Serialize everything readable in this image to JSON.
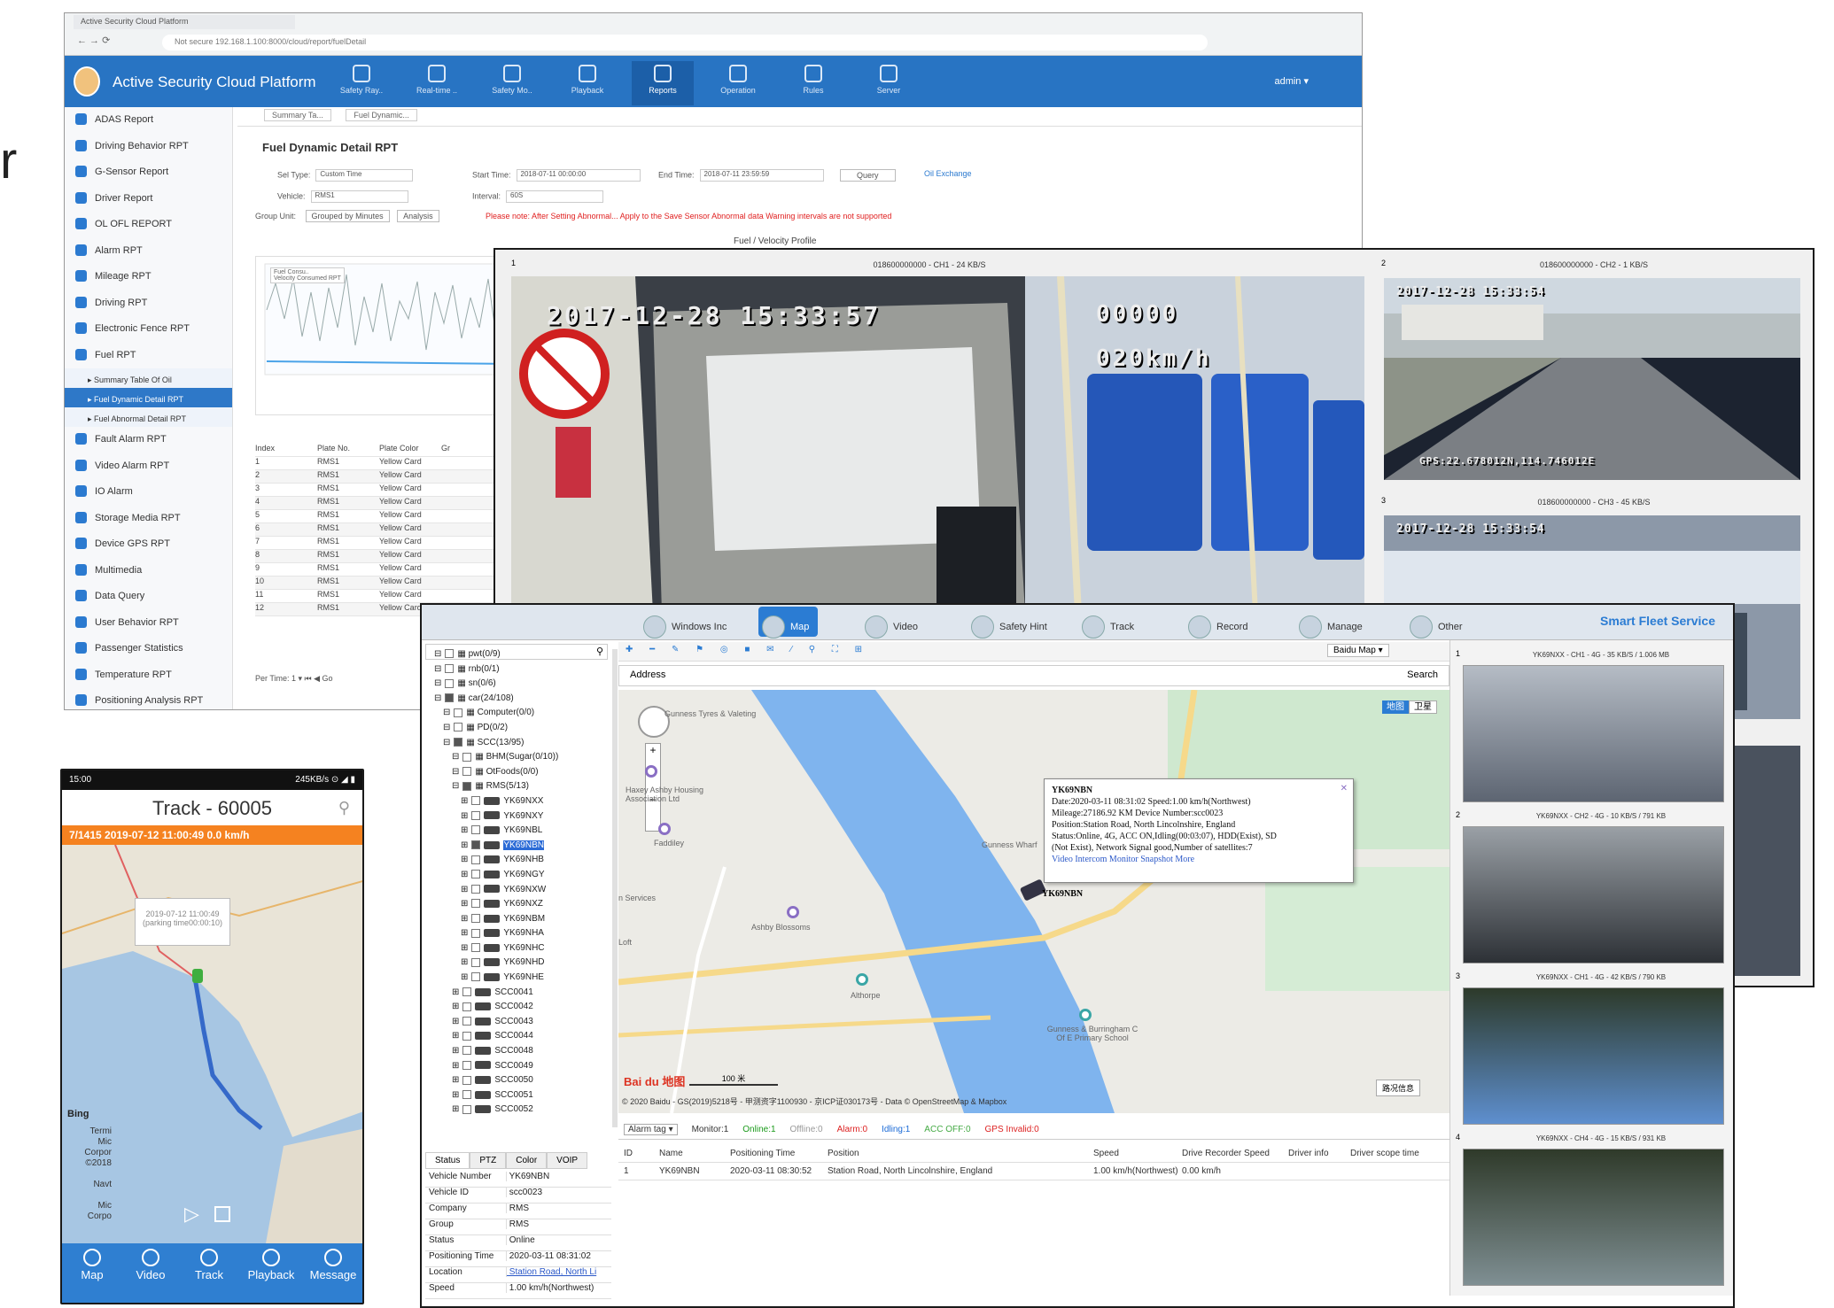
{
  "fragment_letter": "r",
  "web": {
    "tab": "Active Security Cloud Platform",
    "url": "Not secure  192.168.1.100:8000/cloud/report/fuelDetail",
    "app_title": "Active Security Cloud Platform",
    "nav": [
      "Safety Ray..",
      "Real-time ..",
      "Safety Mo..",
      "Playback",
      "Reports",
      "Operation",
      "Rules",
      "Server"
    ],
    "user": "admin ▾",
    "sidebar": [
      "ADAS Report",
      "Driving Behavior RPT",
      "G-Sensor Report",
      "Driver Report",
      "OL OFL REPORT",
      "Alarm RPT",
      "Mileage RPT",
      "Driving RPT",
      "Electronic Fence RPT",
      "Fuel RPT"
    ],
    "sidebar_sub": [
      "Summary Table Of Oil",
      "Fuel Dynamic Detail RPT",
      "Fuel Abnormal Detail RPT"
    ],
    "sidebar_rest": [
      "Fault Alarm RPT",
      "Video Alarm RPT",
      "IO Alarm",
      "Storage Media RPT",
      "Device GPS RPT",
      "Multimedia",
      "Data Query",
      "User Behavior RPT",
      "Passenger Statistics",
      "Temperature RPT",
      "Positioning Analysis RPT"
    ],
    "content_tabs": [
      "Summary Ta...",
      "Fuel Dynamic..."
    ],
    "page_title": "Fuel Dynamic Detail RPT",
    "filters": {
      "sel_type_label": "Sel Type:",
      "sel_type_value": "Custom Time",
      "start_label": "Start Time:",
      "start_value": "2018-07-11 00:00:00",
      "end_label": "End Time:",
      "end_value": "2018-07-11 23:59:59",
      "query": "Query",
      "oil_exchange": "Oil Exchange",
      "vehicle_label": "Vehicle:",
      "vehicle_value": "RMS1",
      "interval_label": "Interval:",
      "interval_value": "60S",
      "group_label": "Group Unit:",
      "group_btn1": "Grouped by Minutes",
      "group_btn2": "Analysis"
    },
    "warning": "Please note: After Setting Abnormal... Apply to the Save Sensor Abnormal data Warning intervals are not supported",
    "chart_title": "Fuel / Velocity Profile",
    "chart_legend": [
      "Fuel Consu..",
      "Velocity Consumed RPT"
    ],
    "table_headers": [
      "Index",
      "Plate No.",
      "Plate Color",
      "Gr"
    ],
    "table_rows": [
      [
        "1",
        "RMS1",
        "Yellow Card"
      ],
      [
        "2",
        "RMS1",
        "Yellow Card"
      ],
      [
        "3",
        "RMS1",
        "Yellow Card"
      ],
      [
        "4",
        "RMS1",
        "Yellow Card"
      ],
      [
        "5",
        "RMS1",
        "Yellow Card"
      ],
      [
        "6",
        "RMS1",
        "Yellow Card"
      ],
      [
        "7",
        "RMS1",
        "Yellow Card"
      ],
      [
        "8",
        "RMS1",
        "Yellow Card"
      ],
      [
        "9",
        "RMS1",
        "Yellow Card"
      ],
      [
        "10",
        "RMS1",
        "Yellow Card"
      ],
      [
        "11",
        "RMS1",
        "Yellow Card"
      ],
      [
        "12",
        "RMS1",
        "Yellow Card"
      ]
    ],
    "pager": "Per Time:  1  ▾   ⏮ ◀   Go"
  },
  "video": {
    "ch1_label": "018600000000 - CH1 - 24 KB/S",
    "ch1_index": "1",
    "ch1_time": "2017-12-28 15:33:57",
    "ch1_counter": "00000",
    "ch1_speed": "020km/h",
    "ch2_label": "018600000000 - CH2 - 1 KB/S",
    "ch2_index": "2",
    "ch2_osd": "2017-12-28 15:33:54",
    "ch2_gps": "GPS:22.678012N,114.746012E",
    "ch3_label": "018600000000 - CH3 - 45 KB/S",
    "ch3_index": "3",
    "ch3_osd": "2017-12-28 15:33:54"
  },
  "mapwin": {
    "nav": [
      "Windows Inc",
      "Map",
      "Video",
      "Safety Hint",
      "Track",
      "Record",
      "Manage",
      "Other"
    ],
    "brand": "Smart Fleet Service",
    "map_select": "Baidu Map ▾",
    "address_label": "Address",
    "search": "Search",
    "tree": [
      "pwt(0/9)",
      "rnb(0/1)",
      "sn(0/6)",
      "car(24/108)",
      "Computer(0/0)",
      "PD(0/2)",
      "SCC(13/95)",
      "BHM(Sugar(0/10))",
      "OtFoods(0/0)",
      "RMS(5/13)",
      "YK69NXX",
      "YK69NXY",
      "YK69NBL",
      "YK69NBN",
      "YK69NHB",
      "YK69NGY",
      "YK69NXW",
      "YK69NXZ",
      "YK69NBM",
      "YK69NHA",
      "YK69NHC",
      "YK69NHD",
      "YK69NHE",
      "SCC0041",
      "SCC0042",
      "SCC0043",
      "SCC0044",
      "SCC0048",
      "SCC0049",
      "SCC0050",
      "SCC0051",
      "SCC0052"
    ],
    "popup": {
      "plate": "YK69NBN",
      "line1": "Date:2020-03-11 08:31:02    Speed:1.00 km/h(Northwest)",
      "line2": "Mileage:27186.92 KM    Device Number:scc0023",
      "line3": "Position:Station Road, North Lincolnshire, England",
      "line4": "Status:Online, 4G, ACC ON,Idling(00:03:07), HDD(Exist), SD",
      "line5": "(Not Exist), Network Signal good,Number of satellites:7",
      "links": "Video  Intercom  Monitor  Snapshot  More"
    },
    "marker_label": "YK69NBN",
    "layer_btns": [
      "地图",
      "卫星"
    ],
    "pois": [
      "Gunness Tyres & Valeting",
      "Haxey Ashby Housing Association Ltd",
      "Gunness Wharf",
      "Ashby Blossoms",
      "Althorpe",
      "Gunness & Burringham C Of E Primary School",
      "n Services",
      "Loft",
      "Faddiley"
    ],
    "scale": "100 米",
    "copyright": "© 2020 Baidu - GS(2019)5218号 - 甲测资字1100930 - 京ICP证030173号 - Data © OpenStreetMap & Mapbox",
    "baidu": "Bai du 地图",
    "traffic": "路况信息",
    "status_bar": [
      "Alarm tag ▾",
      "Monitor:1",
      "Online:1",
      "Offline:0",
      "Alarm:0",
      "Idling:1",
      "ACC OFF:0",
      "GPS Invalid:0"
    ],
    "grid_headers": [
      "ID",
      "Name",
      "Positioning Time",
      "Position",
      "Speed",
      "Drive Recorder Speed",
      "Driver info",
      "Driver scope time"
    ],
    "grid_row": [
      "1",
      "YK69NBN",
      "2020-03-11 08:30:52",
      "Station Road, North Lincolnshire, England",
      "1.00 km/h(Northwest)",
      "0.00 km/h",
      "",
      ""
    ],
    "prop_tabs": [
      "Status",
      "PTZ",
      "Color",
      "VOIP"
    ],
    "props": [
      [
        "Vehicle Number",
        "YK69NBN"
      ],
      [
        "Vehicle ID",
        "scc0023"
      ],
      [
        "Company",
        "RMS"
      ],
      [
        "Group",
        "RMS"
      ],
      [
        "Status",
        "Online"
      ],
      [
        "Positioning Time",
        "2020-03-11 08:31:02"
      ],
      [
        "Location",
        "Station Road, North Li"
      ],
      [
        "Speed",
        "1.00 km/h(Northwest)"
      ]
    ],
    "thumb_labels": [
      "YK69NXX - CH1 - 4G - 35 KB/S / 1.006 MB",
      "YK69NXX - CH2 - 4G - 10 KB/S / 791 KB",
      "YK69NXX - CH1 - 4G - 42 KB/S / 790 KB",
      "YK69NXX - CH4 - 4G - 15 KB/S / 931 KB"
    ],
    "thumb_index": [
      "1",
      "2",
      "3",
      "4"
    ]
  },
  "phone": {
    "status_left": "15:00",
    "status_right": "245KB/s ⊙ ◢ ▮",
    "title": "Track - 60005",
    "banner": "7/1415  2019-07-12 11:00:49  0.0 km/h",
    "bubble_l1": "2019-07-12 11:00:49",
    "bubble_l2": "(parking time00:00:10)",
    "bing": "Bing",
    "map_texts": [
      "Termi",
      "Mic",
      "Corpor",
      "©2018",
      "Navt",
      "Mic",
      "Corpo"
    ],
    "tabs": [
      "Map",
      "Video",
      "Track",
      "Playback",
      "Message"
    ]
  },
  "colors": {
    "appbar": "#2874c3",
    "orange": "#f58220",
    "river": "#7fb4ee"
  }
}
